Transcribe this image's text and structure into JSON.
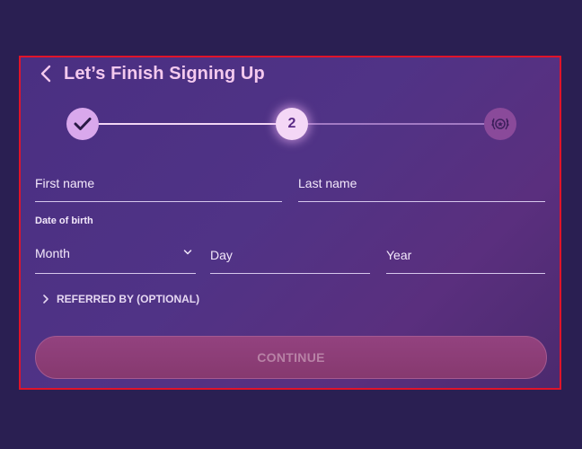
{
  "header": {
    "title": "Let’s Finish Signing Up",
    "back_icon": "chevron-left-icon"
  },
  "stepper": {
    "steps": [
      {
        "state": "complete",
        "icon": "checkmark-icon"
      },
      {
        "state": "current",
        "label": "2"
      },
      {
        "state": "upcoming",
        "icon": "laurel-star-icon"
      }
    ],
    "current_step": 2,
    "total_steps": 3
  },
  "form": {
    "first_name": {
      "placeholder": "First name",
      "value": ""
    },
    "last_name": {
      "placeholder": "Last name",
      "value": ""
    },
    "dob_label": "Date of birth",
    "month": {
      "placeholder": "Month",
      "value": ""
    },
    "day": {
      "placeholder": "Day",
      "value": ""
    },
    "year": {
      "placeholder": "Year",
      "value": ""
    },
    "referred_label": "REFERRED BY (OPTIONAL)"
  },
  "actions": {
    "continue_label": "CONTINUE"
  },
  "colors": {
    "title": "#f4c9ee",
    "panel_border": "#e0142a",
    "button": "#8c3d77"
  }
}
